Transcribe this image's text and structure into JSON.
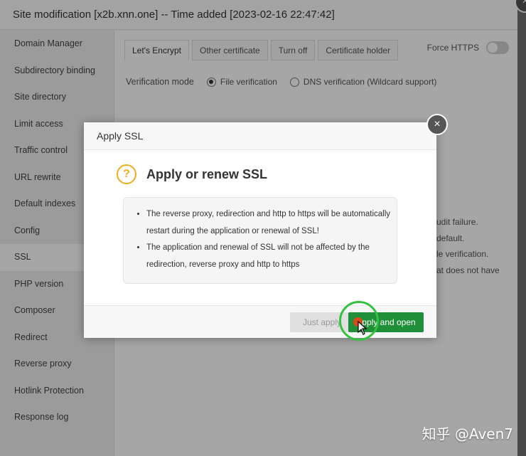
{
  "window": {
    "title": "Site modification [x2b.xnn.one] -- Time added [2023-02-16 22:47:42]",
    "close_icon": "×"
  },
  "sidebar": {
    "items": [
      {
        "label": "Domain Manager"
      },
      {
        "label": "Subdirectory binding"
      },
      {
        "label": "Site directory"
      },
      {
        "label": "Limit access"
      },
      {
        "label": "Traffic control"
      },
      {
        "label": "URL rewrite"
      },
      {
        "label": "Default indexes"
      },
      {
        "label": "Config"
      },
      {
        "label": "SSL",
        "active": true
      },
      {
        "label": "PHP version"
      },
      {
        "label": "Composer"
      },
      {
        "label": "Redirect"
      },
      {
        "label": "Reverse proxy"
      },
      {
        "label": "Hotlink Protection"
      },
      {
        "label": "Response log"
      }
    ]
  },
  "ssl": {
    "tabs": [
      "Let's Encrypt",
      "Other certificate",
      "Turn off",
      "Certificate holder"
    ],
    "active_tab": "Let's Encrypt",
    "force_https_label": "Force HTTPS",
    "force_https_on": false,
    "verification_label": "Verification mode",
    "verification_options": [
      "File verification",
      "DNS verification (Wildcard support)"
    ],
    "verification_selected": "File verification",
    "bg_notes": [
      "udit failure.",
      "default.",
      "le verification.",
      "at does not have"
    ]
  },
  "dialog": {
    "title": "Apply SSL",
    "heading": "Apply or renew SSL",
    "bullets": [
      "The reverse proxy, redirection and http to https will be automatically restart during the application or renewal of SSL!",
      "The application and renewal of SSL will not be affected by the redirection, reverse proxy and http to https"
    ],
    "just_apply_label": "Just apply",
    "apply_open_label": "Apply and open",
    "close_icon": "×"
  },
  "colors": {
    "primary_button": "#1f8f3a",
    "warning_icon": "#f0ad1e",
    "highlight_ring": "#33c13f"
  },
  "watermark": "知乎 @Aven7"
}
